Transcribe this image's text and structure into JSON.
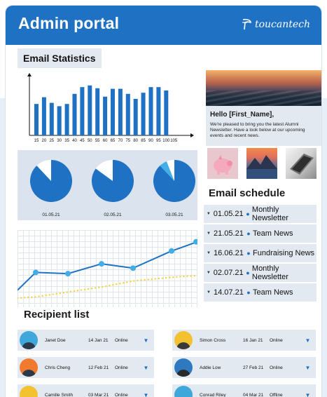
{
  "header": {
    "title": "Admin portal",
    "logo_text": "toucantech"
  },
  "email_stats": {
    "title": "Email Statistics",
    "chart_data": [
      {
        "type": "bar",
        "categories": [
          "15",
          "20",
          "25",
          "30",
          "35",
          "40",
          "45",
          "50",
          "55",
          "60",
          "65",
          "70",
          "75",
          "80",
          "85",
          "90",
          "95",
          "100",
          "105"
        ],
        "values": [
          56,
          68,
          58,
          52,
          56,
          74,
          86,
          89,
          84,
          69,
          83,
          83,
          74,
          65,
          76,
          86,
          86,
          80
        ],
        "ylim": [
          0,
          100
        ],
        "title": "",
        "xlabel": "",
        "ylabel": "",
        "color": "#1f72c3"
      },
      {
        "type": "pie",
        "pies": [
          {
            "label": "01.05.21",
            "values": [
              88,
              12
            ],
            "colors": [
              "#1f72c3",
              "#ffffff"
            ]
          },
          {
            "label": "02.05.21",
            "values": [
              85,
              15
            ],
            "colors": [
              "#1f72c3",
              "#ffffff"
            ]
          },
          {
            "label": "03.05.21",
            "values": [
              88,
              6,
              6
            ],
            "colors": [
              "#1f72c3",
              "#42aee6",
              "#ffffff"
            ]
          }
        ]
      },
      {
        "type": "line",
        "x": [
          0,
          1,
          2,
          3,
          4,
          5,
          6
        ],
        "series": [
          {
            "values": [
              21,
              50,
              48,
              64,
              57,
              85,
              100
            ],
            "color": "#1f72c3",
            "style": "solid"
          },
          {
            "values": [
              8,
              10,
              18,
              26,
              36,
              42,
              45
            ],
            "color": "#f2d443",
            "style": "dotted"
          }
        ],
        "ylim": [
          0,
          110
        ]
      }
    ]
  },
  "newsletter": {
    "greeting": "Hello [First_Name],",
    "body": "We're pleased to bring you the latest Alumni Newsletter. Have a look below at our upcoming events and recent news."
  },
  "schedule": {
    "title": "Email schedule",
    "items": [
      {
        "date": "01.05.21",
        "name": "Monthly Newsletter"
      },
      {
        "date": "21.05.21",
        "name": "Team News"
      },
      {
        "date": "16.06.21",
        "name": "Fundraising News"
      },
      {
        "date": "02.07.21",
        "name": "Monthly Newsletter"
      },
      {
        "date": "14.07.21",
        "name": "Team News"
      }
    ]
  },
  "recipients": {
    "title": "Recipient list",
    "rows": [
      {
        "name": "Janet Doe",
        "date": "14 Jan 21",
        "status": "Online"
      },
      {
        "name": "Simon Cross",
        "date": "16 Jan 21",
        "status": "Online"
      },
      {
        "name": "Chris Cheng",
        "date": "12 Feb 21",
        "status": "Online"
      },
      {
        "name": "Addie Low",
        "date": "27 Feb 21",
        "status": "Online"
      },
      {
        "name": "Camille Smith",
        "date": "03 Mar 21",
        "status": "Online"
      },
      {
        "name": "Conrad Riley",
        "date": "04 Mar 21",
        "status": "Offline"
      }
    ]
  },
  "colors": {
    "brand": "#1f72c3",
    "accent_light": "#42aee6",
    "panel": "#e3e9f1",
    "trend": "#f2d443"
  }
}
